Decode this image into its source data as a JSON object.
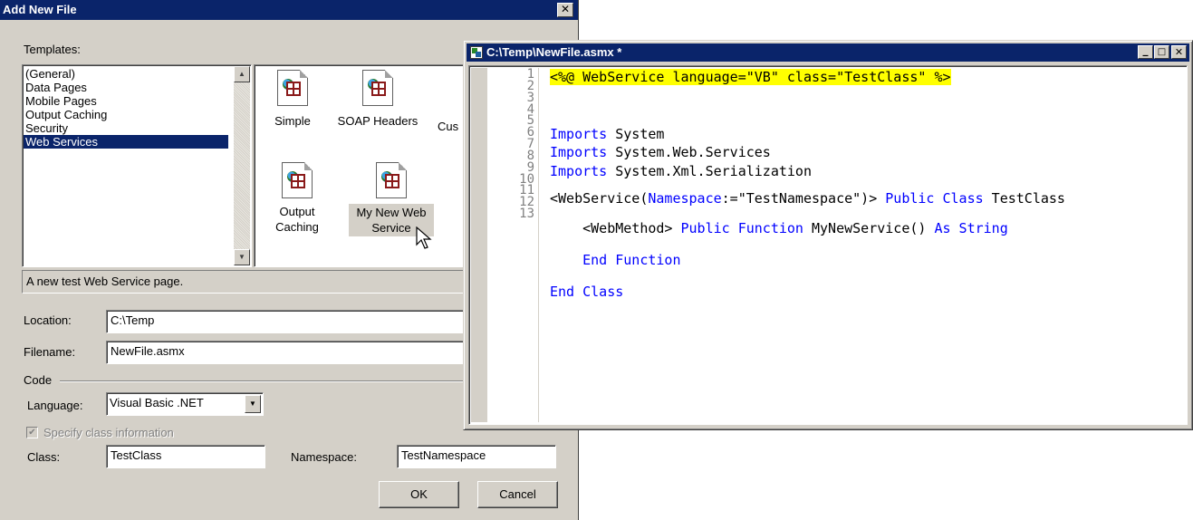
{
  "dialog": {
    "title": "Add New File",
    "templates_label": "Templates:",
    "categories": [
      "(General)",
      "Data Pages",
      "Mobile Pages",
      "Output Caching",
      "Security",
      "Web Services"
    ],
    "selected_category": "Web Services",
    "templates": [
      {
        "label1": "Simple",
        "label2": ""
      },
      {
        "label1": "SOAP Headers",
        "label2": ""
      },
      {
        "label1": "Cus",
        "label2": ""
      },
      {
        "label1": "Output",
        "label2": "Caching"
      },
      {
        "label1": "My New Web",
        "label2": "Service"
      }
    ],
    "selected_template": "My New Web Service",
    "description": "A new test Web Service page.",
    "location_label": "Location:",
    "location_value": "C:\\Temp",
    "filename_label": "Filename:",
    "filename_value": "NewFile.asmx",
    "code_group_label": "Code",
    "language_label": "Language:",
    "language_value": "Visual Basic .NET",
    "specify_class_label": "Specify class information",
    "specify_class_checked": true,
    "class_label": "Class:",
    "class_value": "TestClass",
    "namespace_label": "Namespace:",
    "namespace_value": "TestNamespace",
    "ok_label": "OK",
    "cancel_label": "Cancel",
    "close_glyph": "✕"
  },
  "editor": {
    "title": "C:\\Temp\\NewFile.asmx *",
    "line_numbers": [
      "1",
      "2",
      "3",
      "4",
      "5",
      "6",
      "7",
      "8",
      "9",
      "10",
      "11",
      "12",
      "13"
    ],
    "code_lines": [
      [
        {
          "t": "<%@ WebService language=\"VB\" class=\"TestClass\" %>",
          "c": "hl"
        }
      ],
      [
        {
          "t": "Imports",
          "c": "kw"
        },
        {
          "t": " System",
          "c": ""
        }
      ],
      [
        {
          "t": "Imports",
          "c": "kw"
        },
        {
          "t": " System.Web.Services",
          "c": ""
        }
      ],
      [
        {
          "t": "Imports",
          "c": "kw"
        },
        {
          "t": " System.Xml.Serialization",
          "c": ""
        }
      ],
      [
        {
          "t": "<WebService(",
          "c": ""
        },
        {
          "t": "Namespace",
          "c": "kw"
        },
        {
          "t": ":=\"TestNamespace\")> ",
          "c": ""
        },
        {
          "t": "Public Class",
          "c": "kw"
        },
        {
          "t": " TestClass",
          "c": ""
        }
      ],
      [
        {
          "t": "    <WebMethod> ",
          "c": ""
        },
        {
          "t": "Public Function",
          "c": "kw"
        },
        {
          "t": " MyNewService() ",
          "c": ""
        },
        {
          "t": "As String",
          "c": "kw"
        }
      ],
      [
        {
          "t": "    ",
          "c": ""
        },
        {
          "t": "End Function",
          "c": "kw"
        }
      ],
      [
        {
          "t": "End Class",
          "c": "kw"
        }
      ]
    ]
  }
}
